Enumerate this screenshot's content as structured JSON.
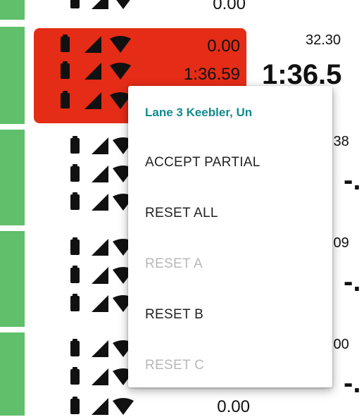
{
  "lanes": [
    {
      "name": "lane-top-partial",
      "splits": [
        "0.00"
      ]
    },
    {
      "name": "lane-3",
      "selected": true,
      "splits": [
        "0.00",
        "1:36.59",
        ""
      ],
      "small": "32.30",
      "big": "1:36.5"
    },
    {
      "name": "lane-4",
      "small": ".38",
      "big": "-."
    },
    {
      "name": "lane-5",
      "small": ".09",
      "big": "-."
    },
    {
      "name": "lane-6",
      "small": ".00",
      "big": "-.",
      "splits_bottom": [
        "0.00"
      ]
    }
  ],
  "menu": {
    "title": "Lane 3 Keebler, Un",
    "items": [
      {
        "label": "ACCEPT PARTIAL",
        "enabled": true
      },
      {
        "label": "RESET ALL",
        "enabled": true
      },
      {
        "label": "RESET A",
        "enabled": false
      },
      {
        "label": "RESET B",
        "enabled": true
      },
      {
        "label": "RESET C",
        "enabled": false
      }
    ]
  },
  "colors": {
    "green": "#5fbf6a",
    "red": "#e42c17",
    "teal": "#118a8c"
  },
  "icons": [
    "battery-icon",
    "signal-icon",
    "wifi-icon"
  ]
}
